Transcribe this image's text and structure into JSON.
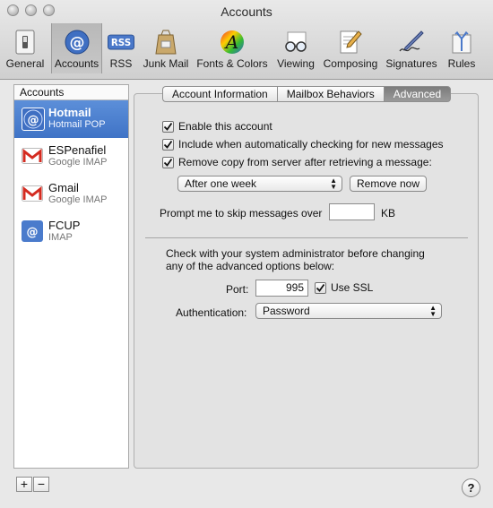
{
  "window": {
    "title": "Accounts"
  },
  "toolbar": {
    "items": [
      {
        "label": "General",
        "icon": "light-switch-icon"
      },
      {
        "label": "Accounts",
        "icon": "at-sign-icon"
      },
      {
        "label": "RSS",
        "icon": "rss-icon"
      },
      {
        "label": "Junk Mail",
        "icon": "junk-mail-bag-icon"
      },
      {
        "label": "Fonts & Colors",
        "icon": "fonts-colors-icon"
      },
      {
        "label": "Viewing",
        "icon": "glasses-icon"
      },
      {
        "label": "Composing",
        "icon": "compose-pencil-icon"
      },
      {
        "label": "Signatures",
        "icon": "signature-pen-icon"
      },
      {
        "label": "Rules",
        "icon": "rules-arrows-icon"
      }
    ],
    "selected": "Accounts"
  },
  "accounts": {
    "header": "Accounts",
    "items": [
      {
        "name": "Hotmail",
        "type": "Hotmail POP",
        "icon": "at-sign-icon",
        "selected": true
      },
      {
        "name": "ESPenafiel",
        "type": "Google IMAP",
        "icon": "gmail-icon",
        "selected": false
      },
      {
        "name": "Gmail",
        "type": "Google IMAP",
        "icon": "gmail-icon",
        "selected": false
      },
      {
        "name": "FCUP",
        "type": "IMAP",
        "icon": "at-sign-icon",
        "selected": false
      }
    ],
    "add_label": "+",
    "remove_label": "−"
  },
  "tabs": [
    {
      "label": "Account Information",
      "active": false
    },
    {
      "label": "Mailbox Behaviors",
      "active": false
    },
    {
      "label": "Advanced",
      "active": true
    }
  ],
  "advanced": {
    "enable_account": {
      "label": "Enable this account",
      "checked": true
    },
    "include_checking": {
      "label": "Include when automatically checking for new messages",
      "checked": true
    },
    "remove_copy": {
      "label": "Remove copy from server after retrieving a message:",
      "checked": true
    },
    "remove_after": {
      "value": "After one week"
    },
    "remove_now_label": "Remove now",
    "prompt_label": "Prompt me to skip messages over",
    "prompt_value": "",
    "prompt_unit": "KB",
    "admin_note_line1": "Check with your system administrator before changing",
    "admin_note_line2": "any of the advanced options below:",
    "port_label": "Port:",
    "port_value": "995",
    "use_ssl": {
      "label": "Use SSL",
      "checked": true
    },
    "auth_label": "Authentication:",
    "auth_value": "Password"
  },
  "help_label": "?"
}
